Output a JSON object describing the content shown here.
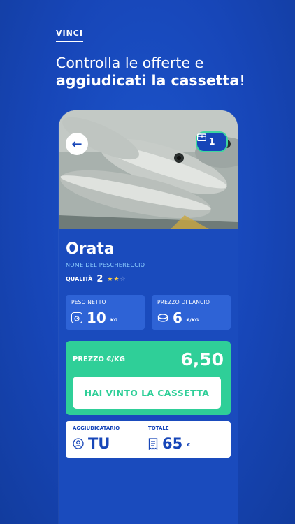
{
  "promo": {
    "kicker": "VINCI",
    "headline_line1": "Controlla le offerte e",
    "headline_bold": "aggiudicati la cassetta",
    "headline_end": "!"
  },
  "header": {
    "crate_count": "1"
  },
  "product": {
    "name": "Orata",
    "boat": "NOME DEL PESCHERECCIO",
    "quality_label": "QUALITÀ",
    "quality_value": "2",
    "quality_stars": "★★",
    "quality_stars_off": "☆"
  },
  "stats": {
    "weight_label": "PESO NETTO",
    "weight_value": "10",
    "weight_unit": "KG",
    "start_price_label": "PREZZO DI LANCIO",
    "start_price_value": "6",
    "start_price_unit": "€/KG"
  },
  "price": {
    "label": "PREZZO €/KG",
    "value": "6,50",
    "button_label": "HAI VINTO LA CASSETTA"
  },
  "result": {
    "winner_label": "AGGIUDICATARIO",
    "winner_value": "TU",
    "total_label": "TOTALE",
    "total_value": "65",
    "total_unit": "€"
  },
  "colors": {
    "background": "#1746b8",
    "accent_green": "#2fcf98",
    "card_blue": "#2e63d6",
    "star": "#f7c948"
  }
}
